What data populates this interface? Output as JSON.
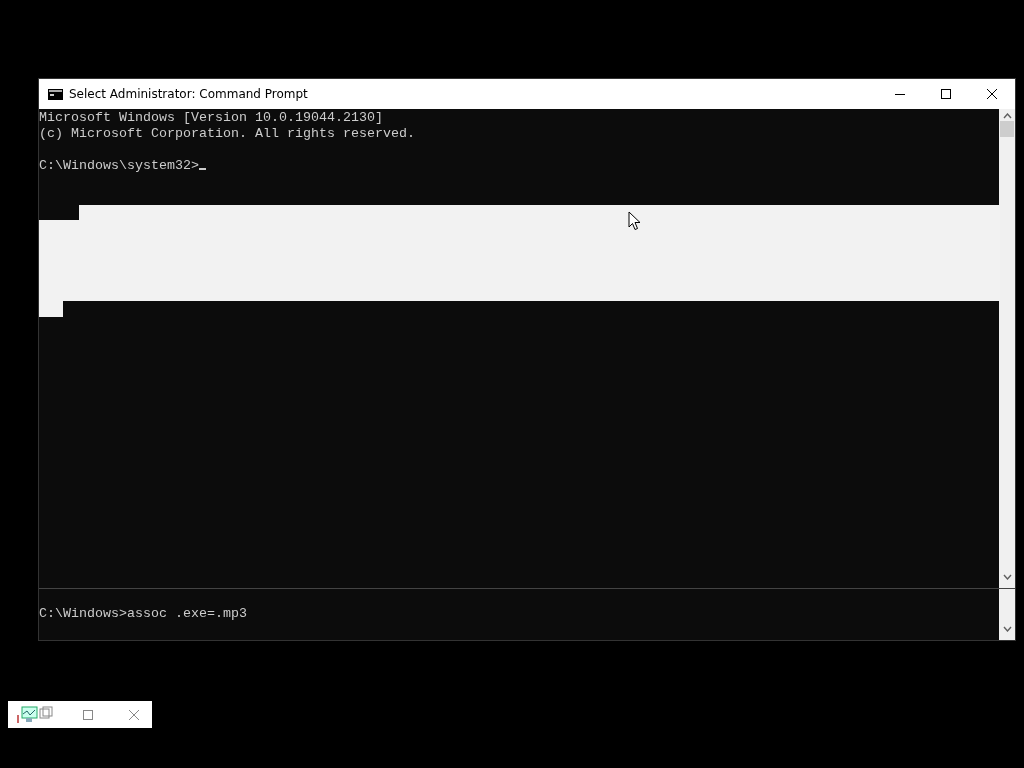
{
  "window": {
    "title": "Select Administrator:  Command Prompt"
  },
  "console": {
    "paragraphs": [
      {
        "lines": [
          {
            "text": "Microsoft Windows [Version 10.0.19044.2130]",
            "cursor": false
          },
          {
            "text": "(c) Microsoft Corporation. All rights reserved.",
            "cursor": false
          }
        ]
      },
      {
        "lines": [
          {
            "text": "C:\\Windows\\system32>",
            "cursor": true
          }
        ]
      }
    ]
  },
  "lower_pane": {
    "lines": [
      {
        "text": "C:\\Windows>assoc .exe=.mp3",
        "cursor": false
      }
    ]
  }
}
